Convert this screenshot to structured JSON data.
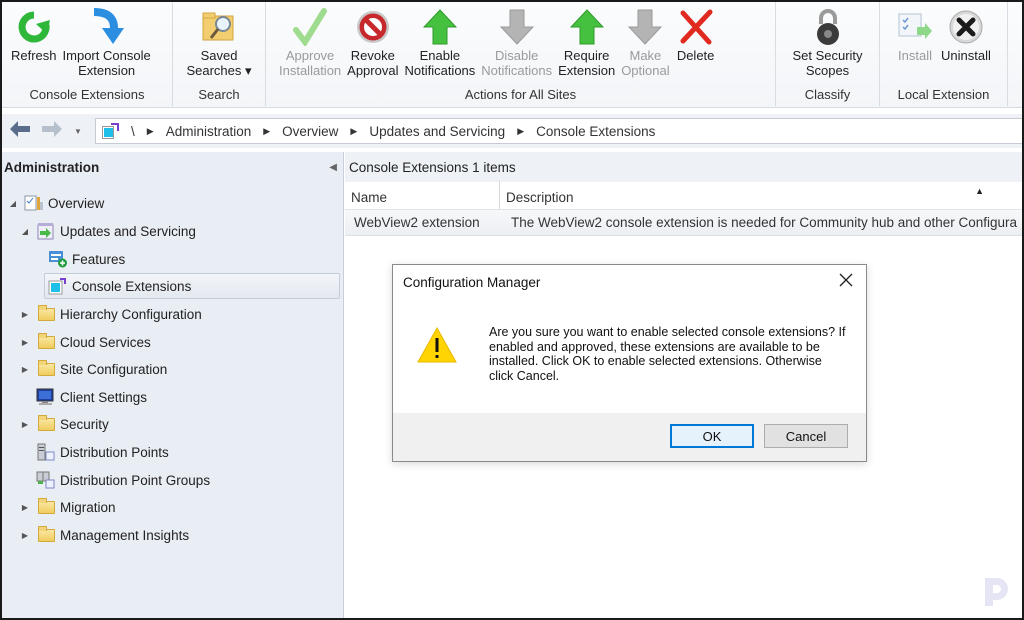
{
  "ribbon": {
    "groups": [
      {
        "label": "Console Extensions",
        "buttons": [
          {
            "label": "Refresh",
            "icon": "refresh-icon",
            "enabled": true
          },
          {
            "label": "Import Console\nExtension",
            "icon": "import-icon",
            "enabled": true
          }
        ]
      },
      {
        "label": "Search",
        "buttons": [
          {
            "label": "Saved\nSearches ▾",
            "icon": "saved-searches-icon",
            "enabled": true
          }
        ]
      },
      {
        "label": "Actions for All Sites",
        "buttons": [
          {
            "label": "Approve\nInstallation",
            "icon": "checkmark-icon",
            "enabled": false
          },
          {
            "label": "Revoke\nApproval",
            "icon": "prohibited-icon",
            "enabled": true
          },
          {
            "label": "Enable\nNotifications",
            "icon": "arrow-up-icon",
            "enabled": true
          },
          {
            "label": "Disable\nNotifications",
            "icon": "arrow-down-icon",
            "enabled": false
          },
          {
            "label": "Require\nExtension",
            "icon": "arrow-up-icon",
            "enabled": true
          },
          {
            "label": "Make\nOptional",
            "icon": "arrow-down-icon",
            "enabled": false
          },
          {
            "label": "Delete",
            "icon": "delete-icon",
            "enabled": true
          }
        ]
      },
      {
        "label": "Classify",
        "buttons": [
          {
            "label": "Set Security\nScopes",
            "icon": "padlock-icon",
            "enabled": true
          }
        ]
      },
      {
        "label": "Local Extension",
        "buttons": [
          {
            "label": "Install",
            "icon": "install-icon",
            "enabled": false
          },
          {
            "label": "Uninstall",
            "icon": "uninstall-icon",
            "enabled": true
          }
        ]
      }
    ]
  },
  "nav": {
    "root": "\\",
    "breadcrumbs": [
      "Administration",
      "Overview",
      "Updates and Servicing",
      "Console Extensions"
    ]
  },
  "tree": {
    "title": "Administration",
    "items": [
      {
        "label": "Overview",
        "level": 0,
        "expander": "expanded",
        "icon": "overview-icon"
      },
      {
        "label": "Updates and Servicing",
        "level": 1,
        "expander": "expanded",
        "icon": "updates-icon"
      },
      {
        "label": "Features",
        "level": 2,
        "expander": "none",
        "icon": "features-icon"
      },
      {
        "label": "Console Extensions",
        "level": 2,
        "expander": "none",
        "icon": "console-extensions-icon",
        "selected": true
      },
      {
        "label": "Hierarchy Configuration",
        "level": 1,
        "expander": "collapsed",
        "icon": "folder-icon"
      },
      {
        "label": "Cloud Services",
        "level": 1,
        "expander": "collapsed",
        "icon": "folder-icon"
      },
      {
        "label": "Site Configuration",
        "level": 1,
        "expander": "collapsed",
        "icon": "folder-icon"
      },
      {
        "label": "Client Settings",
        "level": 1,
        "expander": "none",
        "icon": "monitor-icon"
      },
      {
        "label": "Security",
        "level": 1,
        "expander": "collapsed",
        "icon": "folder-icon"
      },
      {
        "label": "Distribution Points",
        "level": 1,
        "expander": "none",
        "icon": "server-icon"
      },
      {
        "label": "Distribution Point Groups",
        "level": 1,
        "expander": "none",
        "icon": "server-group-icon"
      },
      {
        "label": "Migration",
        "level": 1,
        "expander": "collapsed",
        "icon": "folder-icon"
      },
      {
        "label": "Management Insights",
        "level": 1,
        "expander": "collapsed",
        "icon": "folder-icon"
      }
    ]
  },
  "list": {
    "title": "Console Extensions 1 items",
    "columns": [
      "Name",
      "Description"
    ],
    "rows": [
      {
        "name": "WebView2 extension",
        "description": "The WebView2 console extension is needed for Community hub and other Configura"
      }
    ]
  },
  "dialog": {
    "title": "Configuration Manager",
    "message": "Are you sure you want to enable selected console extensions? If enabled and approved, these extensions are available to be installed. Click OK to enable selected extensions. Otherwise click Cancel.",
    "ok_label": "OK",
    "cancel_label": "Cancel"
  },
  "colors": {
    "accent": "#0078d7",
    "tree_bg": "#e9edf4",
    "warning": "#f5c400"
  }
}
